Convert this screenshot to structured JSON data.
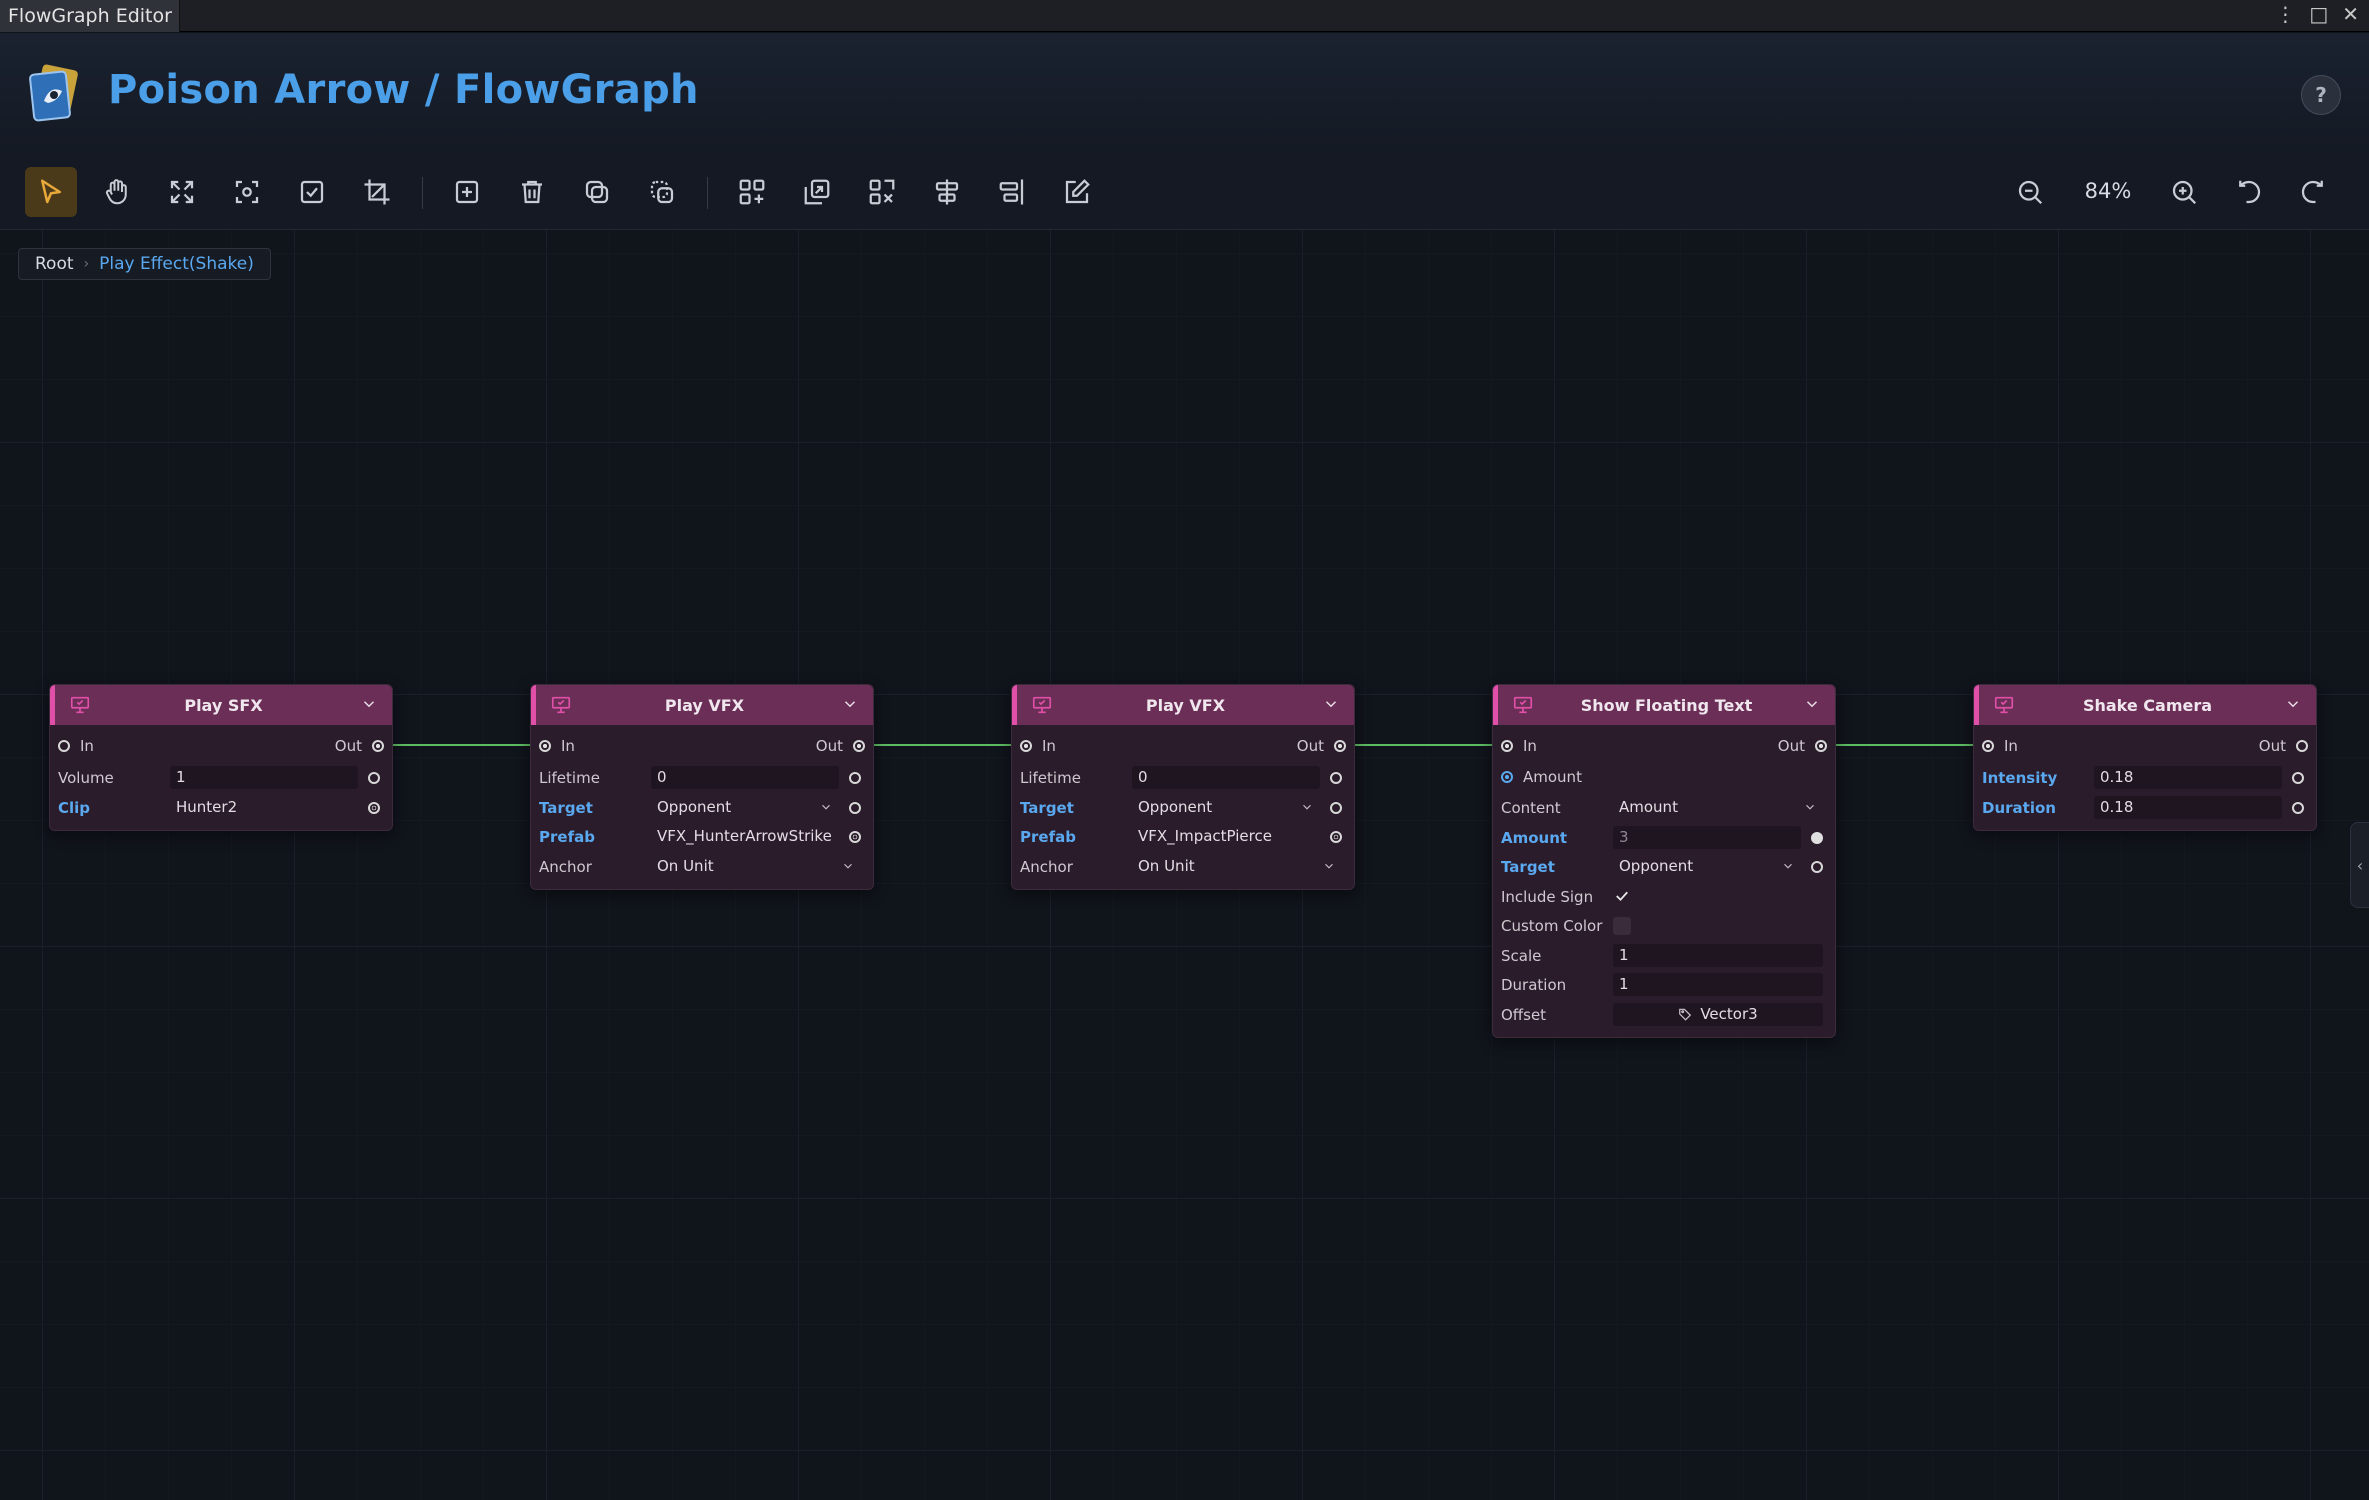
{
  "window": {
    "tab_title": "FlowGraph Editor"
  },
  "header": {
    "title": "Poison Arrow / FlowGraph",
    "help_label": "?"
  },
  "toolbar": {
    "zoom": "84%"
  },
  "breadcrumb": {
    "root": "Root",
    "separator": "›",
    "current": "Play Effect(Shake)"
  },
  "colors": {
    "accent": "#4a9fe8",
    "node_header": "#6b2e57",
    "node_accent": "#e050a8",
    "wire": "#5dbb63",
    "link_label": "#5aa8ef"
  },
  "nodes": {
    "play_sfx": {
      "title": "Play SFX",
      "in": "In",
      "out": "Out",
      "fields": {
        "volume_label": "Volume",
        "volume": "1",
        "clip_label": "Clip",
        "clip": "Hunter2"
      }
    },
    "play_vfx_1": {
      "title": "Play VFX",
      "in": "In",
      "out": "Out",
      "fields": {
        "lifetime_label": "Lifetime",
        "lifetime": "0",
        "target_label": "Target",
        "target": "Opponent",
        "prefab_label": "Prefab",
        "prefab": "VFX_HunterArrowStrike",
        "anchor_label": "Anchor",
        "anchor": "On Unit"
      }
    },
    "play_vfx_2": {
      "title": "Play VFX",
      "in": "In",
      "out": "Out",
      "fields": {
        "lifetime_label": "Lifetime",
        "lifetime": "0",
        "target_label": "Target",
        "target": "Opponent",
        "prefab_label": "Prefab",
        "prefab": "VFX_ImpactPierce",
        "anchor_label": "Anchor",
        "anchor": "On Unit"
      }
    },
    "show_floating_text": {
      "title": "Show Floating Text",
      "in": "In",
      "out": "Out",
      "amount_in": "Amount",
      "fields": {
        "content_label": "Content",
        "content": "Amount",
        "amount_label": "Amount",
        "amount": "3",
        "target_label": "Target",
        "target": "Opponent",
        "include_sign_label": "Include Sign",
        "custom_color_label": "Custom Color",
        "scale_label": "Scale",
        "scale": "1",
        "duration_label": "Duration",
        "duration": "1",
        "offset_label": "Offset",
        "offset": "Vector3"
      }
    },
    "shake_camera": {
      "title": "Shake Camera",
      "in": "In",
      "out": "Out",
      "fields": {
        "intensity_label": "Intensity",
        "intensity": "0.18",
        "duration_label": "Duration",
        "duration": "0.18"
      }
    }
  }
}
